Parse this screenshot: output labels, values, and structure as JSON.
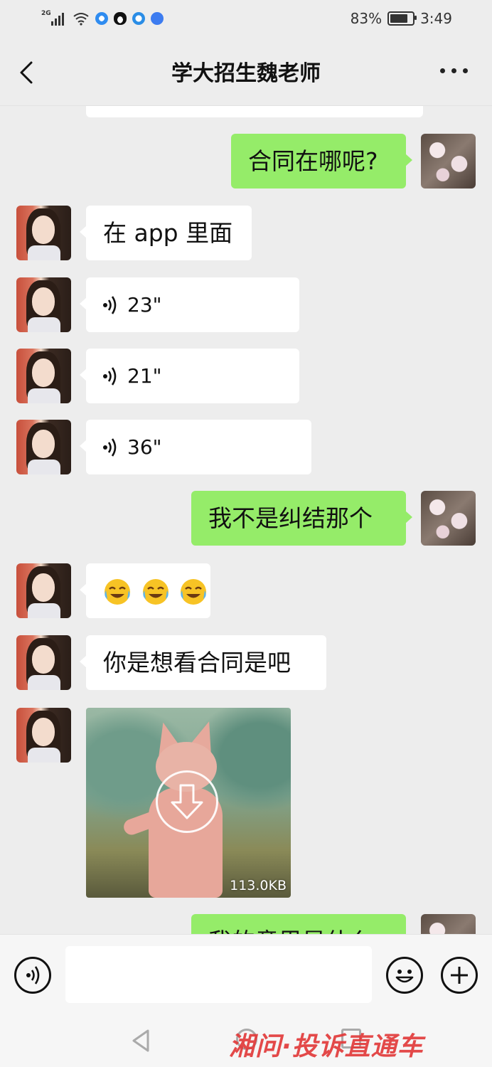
{
  "status_bar": {
    "network": "2G",
    "battery": "83%",
    "time": "3:49"
  },
  "header": {
    "title": "学大招生魏老师"
  },
  "messages": [
    {
      "side": "right",
      "type": "text",
      "text": "合同在哪呢?"
    },
    {
      "side": "left",
      "type": "text",
      "text": "在 app 里面"
    },
    {
      "side": "left",
      "type": "voice",
      "duration": "23\""
    },
    {
      "side": "left",
      "type": "voice",
      "duration": "21\""
    },
    {
      "side": "left",
      "type": "voice",
      "duration": "36\""
    },
    {
      "side": "right",
      "type": "text",
      "text": "我不是纠结那个"
    },
    {
      "side": "left",
      "type": "emoji",
      "count": 3,
      "emoji": "crying-laughing-face"
    },
    {
      "side": "left",
      "type": "text",
      "text": "你是想看合同是吧"
    },
    {
      "side": "left",
      "type": "image",
      "size": "113.0KB"
    },
    {
      "side": "right",
      "type": "text",
      "text": "我的意思是什么"
    }
  ],
  "input_bar": {
    "placeholder": "",
    "icons": [
      "voice-icon",
      "emoji-icon",
      "plus-icon"
    ]
  },
  "watermark": "湘问·投诉直通车",
  "colors": {
    "background": "#ededed",
    "outgoing_bubble": "#95ec69",
    "incoming_bubble": "#ffffff",
    "watermark": "#e23b3b"
  }
}
